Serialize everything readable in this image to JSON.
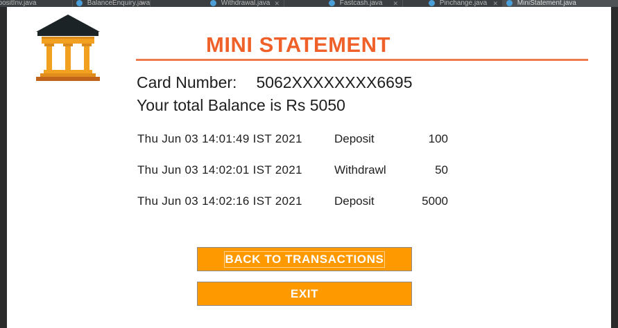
{
  "tabs": [
    {
      "label": "epositInv.java"
    },
    {
      "label": "BalanceEnquiry.java"
    },
    {
      "label": "Withdrawal.java"
    },
    {
      "label": "Fastcash.java"
    },
    {
      "label": "Pinchange.java"
    },
    {
      "label": "MiniStatement.java",
      "active": true
    }
  ],
  "header": {
    "title": "MINI STATEMENT"
  },
  "account": {
    "card_label": "Card Number:",
    "card_number": "5062XXXXXXXX6695",
    "balance_text": "Your total Balance is Rs 5050"
  },
  "transactions": [
    {
      "date": "Thu Jun 03 14:01:49 IST 2021",
      "type": "Deposit",
      "amount": "100"
    },
    {
      "date": "Thu Jun 03 14:02:01 IST 2021",
      "type": "Withdrawl",
      "amount": "50"
    },
    {
      "date": "Thu Jun 03 14:02:16 IST 2021",
      "type": "Deposit",
      "amount": "5000"
    }
  ],
  "buttons": {
    "back_label": "BACK TO TRANSACTIONS",
    "exit_label": "EXIT"
  },
  "colors": {
    "title": "#f0612a",
    "title_rule": "#ee7a4d",
    "button": "#ff9900",
    "logo_roof": "#1b2326",
    "logo_columns": "#f2a01f",
    "logo_base": "#c0641c"
  },
  "icons": {
    "logo": "bank-building-icon"
  }
}
